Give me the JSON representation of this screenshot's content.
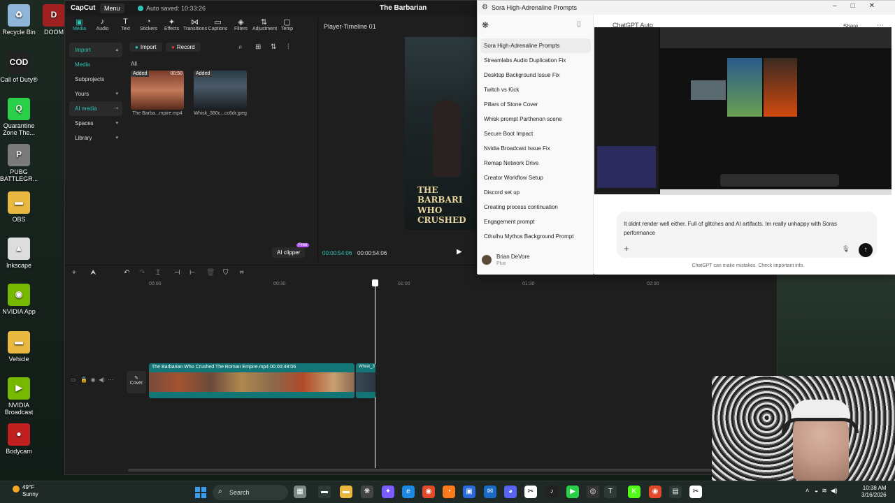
{
  "desktop": {
    "icons": [
      {
        "label": "Recycle Bin",
        "icon": "recycle-bin-icon",
        "color": "#8fb6d8",
        "glyph": "♻"
      },
      {
        "label": "DOOM",
        "icon": "doom-icon",
        "color": "#a02020",
        "glyph": "D"
      },
      {
        "label": "Call of Duty®",
        "icon": "call-of-duty-icon",
        "color": "#222222",
        "glyph": "COD"
      },
      {
        "label": "Quarantine Zone The...",
        "icon": "quarantine-zone-icon",
        "color": "#2bd04a",
        "glyph": "Q"
      },
      {
        "label": "PUBG BATTLEGR...",
        "icon": "pubg-icon",
        "color": "#7a7a7a",
        "glyph": "P"
      },
      {
        "label": "OBS",
        "icon": "obs-folder-icon",
        "color": "#e8b840",
        "glyph": "▬"
      },
      {
        "label": "Inkscape",
        "icon": "inkscape-icon",
        "color": "#dddddd",
        "glyph": "▲"
      },
      {
        "label": "NVIDIA App",
        "icon": "nvidia-app-icon",
        "color": "#76b900",
        "glyph": "◉"
      },
      {
        "label": "Vehicle",
        "icon": "vehicle-folder-icon",
        "color": "#e8b840",
        "glyph": "▬"
      },
      {
        "label": "NVIDIA Broadcast",
        "icon": "nvidia-broadcast-icon",
        "color": "#76b900",
        "glyph": "▶"
      },
      {
        "label": "Bodycam",
        "icon": "bodycam-icon",
        "color": "#c02020",
        "glyph": "●"
      }
    ]
  },
  "capcut": {
    "brand": "CapCut",
    "menu": "Menu",
    "autosave": "Auto saved: 10:33:26",
    "doc_title": "The Barbarian",
    "tools": [
      {
        "label": "Media",
        "glyph": "▣",
        "icon": "media-icon"
      },
      {
        "label": "Audio",
        "glyph": "♪",
        "icon": "audio-icon"
      },
      {
        "label": "Text",
        "glyph": "T",
        "icon": "text-icon"
      },
      {
        "label": "Stickers",
        "glyph": "◔",
        "icon": "stickers-icon"
      },
      {
        "label": "Effects",
        "glyph": "✦",
        "icon": "effects-icon"
      },
      {
        "label": "Transitions",
        "glyph": "⋈",
        "icon": "transitions-icon"
      },
      {
        "label": "Captions",
        "glyph": "▭",
        "icon": "captions-icon"
      },
      {
        "label": "Filters",
        "glyph": "◈",
        "icon": "filters-icon"
      },
      {
        "label": "Adjustment",
        "glyph": "⇅",
        "icon": "adjustment-icon"
      },
      {
        "label": "Temp",
        "glyph": "▢",
        "icon": "templates-icon"
      }
    ],
    "sidebar": [
      {
        "label": "Import",
        "chev": "▴",
        "state": "sel"
      },
      {
        "label": "Media",
        "chev": "",
        "state": "sub"
      },
      {
        "label": "Subprojects",
        "chev": "",
        "state": ""
      },
      {
        "label": "Yours",
        "chev": "▾",
        "state": ""
      },
      {
        "label": "AI media",
        "chev": "⇢",
        "state": "sel"
      },
      {
        "label": "Spaces",
        "chev": "▾",
        "state": ""
      },
      {
        "label": "Library",
        "chev": "▾",
        "state": ""
      }
    ],
    "import_btn": "Import",
    "record_btn": "Record",
    "all_label": "All",
    "media_items": [
      {
        "badge": "Added",
        "duration": "00:50",
        "caption": "The Barba...mpire.mp4"
      },
      {
        "badge": "Added",
        "duration": "",
        "caption": "Whisk_380c...cc6dr.jpeg"
      }
    ],
    "ai_clipper": "AI clipper",
    "ai_clipper_badge": "Free",
    "player_title": "Player-Timeline 01",
    "video_text": "THE BARBARI WHO CRUSHED",
    "timecode_current": "00:00:54:06",
    "timecode_total": "00:00:54:06",
    "ruler": [
      "00:00",
      "00:30",
      "01:00",
      "01:30",
      "02:00"
    ],
    "cover_label": "Cover",
    "clip_label": "The Barbarian Who Crushed The Roman Empire.mp4  00:00:49:06",
    "clip2_label": "Whisk_3"
  },
  "chatgpt": {
    "window_title": "Sora High-Adrenaline Prompts",
    "model_label": "ChatGPT Auto",
    "share_label": "Share",
    "history": [
      "Sora High-Adrenaline Prompts",
      "Streamlabs Audio Duplication Fix",
      "Desktop Background Issue Fix",
      "Twitch vs Kick",
      "Pillars of Stone Cover",
      "Whisk prompt Parthenon scene",
      "Secure Boot Impact",
      "Nvidia Broadcast Issue Fix",
      "Remap Network Drive",
      "Creator Workflow Setup",
      "Discord set up",
      "Creating process continuation",
      "Engagement prompt",
      "Cthulhu Mythos Background Prompt"
    ],
    "user_name": "Brian DeVore",
    "user_plan": "Plus",
    "composer_text": "It didnt render well either. Full of glitches and AI artifacts. Im really unhappy with Soras performance",
    "disclaimer": "ChatGPT can make mistakes. Check important info."
  },
  "taskbar": {
    "temp": "49°F",
    "weather": "Sunny",
    "search": "Search",
    "time": "10:38 AM",
    "date": "3/16/2026"
  }
}
